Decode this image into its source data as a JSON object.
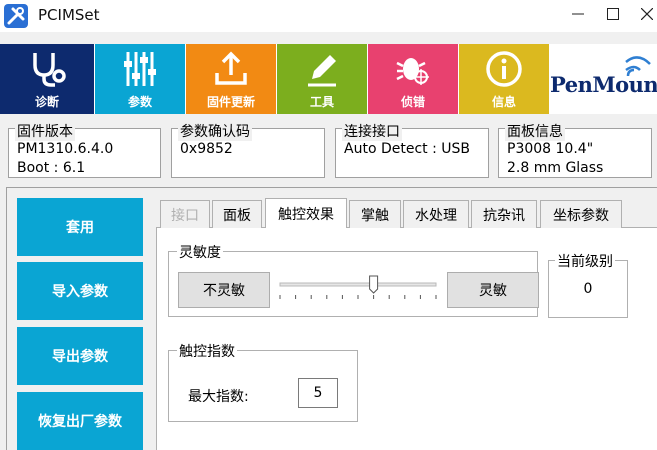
{
  "window": {
    "title": "PCIMSet"
  },
  "toolbar": {
    "items": [
      {
        "label": "诊断",
        "icon": "stethoscope-icon",
        "color": "#0d2a6e"
      },
      {
        "label": "参数",
        "icon": "sliders-icon",
        "color": "#0aa5d3"
      },
      {
        "label": "固件更新",
        "icon": "upload-icon",
        "color": "#f28a13"
      },
      {
        "label": "工具",
        "icon": "pencil-icon",
        "color": "#7cae1e"
      },
      {
        "label": "侦错",
        "icon": "bug-icon",
        "color": "#e8416f"
      },
      {
        "label": "信息",
        "icon": "info-icon",
        "color": "#dbb91f"
      }
    ],
    "logo_text": "PenMount"
  },
  "info": {
    "firmware": {
      "caption": "固件版本",
      "line1": "PM1310.6.4.0",
      "line2": "Boot : 6.1"
    },
    "param_code": {
      "caption": "参数确认码",
      "line1": "0x9852"
    },
    "interface": {
      "caption": "连接接口",
      "line1": "Auto Detect : USB"
    },
    "panel": {
      "caption": "面板信息",
      "line1": "P3008   10.4\"",
      "line2": "2.8 mm Glass"
    }
  },
  "side_buttons": {
    "apply": "套用",
    "import": "导入参数",
    "export": "导出参数",
    "reset": "恢复出厂参数"
  },
  "tabs": [
    "接口",
    "面板",
    "触控效果",
    "掌触",
    "水处理",
    "抗杂讯",
    "坐标参数"
  ],
  "active_tab": "触控效果",
  "sensitivity": {
    "caption": "灵敏度",
    "low_label": "不灵敏",
    "high_label": "灵敏",
    "slider_value": 6,
    "slider_max": 10,
    "current_level_caption": "当前级别",
    "current_level": "0"
  },
  "touch_index": {
    "caption": "触控指数",
    "max_label": "最大指数:",
    "max_value": "5"
  },
  "colors": {
    "accent": "#0aa5d3"
  }
}
